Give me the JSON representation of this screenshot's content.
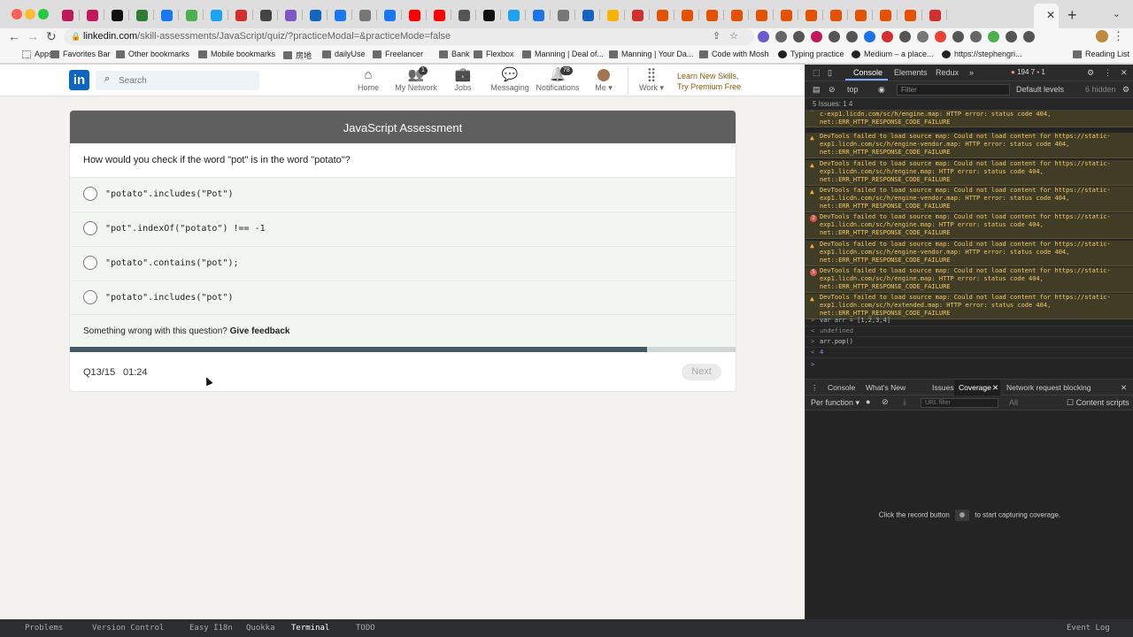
{
  "browser": {
    "url_host": "linkedin.com",
    "url_path": "/skill-assessments/JavaScript/quiz/?practiceModal=&practiceMode=false",
    "bookmarks": [
      {
        "label": "Apps"
      },
      {
        "label": "Favorites Bar"
      },
      {
        "label": "Other bookmarks"
      },
      {
        "label": "Mobile bookmarks"
      },
      {
        "label": "房地"
      },
      {
        "label": "dailyUse"
      },
      {
        "label": "Freelancer"
      },
      {
        "label": "Bank"
      },
      {
        "label": "Flexbox"
      },
      {
        "label": "Manning | Deal of..."
      },
      {
        "label": "Manning | Your Da..."
      },
      {
        "label": "Code with Mosh"
      },
      {
        "label": "Typing practice"
      },
      {
        "label": "Medium – a place..."
      },
      {
        "label": "https://stephengri..."
      }
    ],
    "reading_list": "Reading List",
    "profile_badge": "59",
    "tab_colors": [
      "#c2185b",
      "#c2185b",
      "#111111",
      "#2e7d32",
      "#1877f2",
      "#4caf50",
      "#1da1f2",
      "#d32f2f",
      "#444444",
      "#7e57c2",
      "#1565c0",
      "#1877f2",
      "#777777",
      "#1877f2",
      "#ff0000",
      "#ff0000",
      "#555555",
      "#111111",
      "#1da1f2",
      "#1a73e8",
      "#777777",
      "#1565c0",
      "#f4b400",
      "#d32f2f",
      "#e65100",
      "#e65100",
      "#e65100",
      "#e65100",
      "#e65100",
      "#e65100",
      "#e65100",
      "#e65100",
      "#e65100",
      "#e65100",
      "#e65100",
      "#d32f2f"
    ]
  },
  "linkedin": {
    "search_placeholder": "Search",
    "nav": [
      {
        "label": "Home",
        "icon": "house-icon"
      },
      {
        "label": "My Network",
        "icon": "people-icon",
        "badge": "1"
      },
      {
        "label": "Jobs",
        "icon": "briefcase-icon"
      },
      {
        "label": "Messaging",
        "icon": "chat-icon"
      },
      {
        "label": "Notifications",
        "icon": "bell-icon",
        "badge": "78"
      },
      {
        "label": "Me",
        "icon": "avatar"
      },
      {
        "label": "Work",
        "icon": "grid-icon"
      }
    ],
    "premium_line1": "Learn New Skills,",
    "premium_line2": "Try Premium Free"
  },
  "assessment": {
    "title": "JavaScript Assessment",
    "question": "How would you check if the word \"pot\" is in the word \"potato\"?",
    "options": [
      "\"potato\".includes(\"Pot\")",
      "\"pot\".indexOf(\"potato\") !== -1",
      "\"potato\".contains(\"pot\");",
      "\"potato\".includes(\"pot\")"
    ],
    "feedback_prompt": "Something wrong with this question?",
    "feedback_link": "Give feedback",
    "progress_fraction": 0.8667,
    "question_counter": "Q13/15",
    "timer": "01:24",
    "next_label": "Next"
  },
  "devtools": {
    "tabs": [
      "Console",
      "Elements",
      "Redux",
      "»"
    ],
    "counts": "194  7",
    "errors_count": "1",
    "context": "top",
    "filter_placeholder": "Filter",
    "levels": "Default levels",
    "hidden": "6 hidden",
    "issues": "5 Issues:  1  4",
    "messages": [
      {
        "level": "warn",
        "text": "c-exp1.licdn.com/sc/h/engine.map: HTTP error: status code 404, net::ERR_HTTP_RESPONSE_CODE_FAILURE"
      },
      {
        "level": "warn",
        "text": "DevTools failed to load source map: Could not load content for https://static-exp1.licdn.com/sc/h/engine-vendor.map: HTTP error: status code 404, net::ERR_HTTP_RESPONSE_CODE_FAILURE"
      },
      {
        "level": "warn",
        "text": "DevTools failed to load source map: Could not load content for https://static-exp1.licdn.com/sc/h/engine.map: HTTP error: status code 404, net::ERR_HTTP_RESPONSE_CODE_FAILURE"
      },
      {
        "level": "warn",
        "text": "DevTools failed to load source map: Could not load content for https://static-exp1.licdn.com/sc/h/engine-vendor.map: HTTP error: status code 404, net::ERR_HTTP_RESPONSE_CODE_FAILURE"
      },
      {
        "level": "count",
        "count": "2",
        "text": "DevTools failed to load source map: Could not load content for https://static-exp1.licdn.com/sc/h/engine.map: HTTP error: status code 404, net::ERR_HTTP_RESPONSE_CODE_FAILURE"
      },
      {
        "level": "warn",
        "text": "DevTools failed to load source map: Could not load content for https://static-exp1.licdn.com/sc/h/engine-vendor.map: HTTP error: status code 404, net::ERR_HTTP_RESPONSE_CODE_FAILURE"
      },
      {
        "level": "count",
        "count": "5",
        "text": "DevTools failed to load source map: Could not load content for https://static-exp1.licdn.com/sc/h/engine.map: HTTP error: status code 404, net::ERR_HTTP_RESPONSE_CODE_FAILURE"
      },
      {
        "level": "warn",
        "text": "DevTools failed to load source map: Could not load content for https://static-exp1.licdn.com/sc/h/extended.map: HTTP error: status code 404, net::ERR_HTTP_RESPONSE_CODE_FAILURE"
      }
    ],
    "repl": [
      {
        "prompt": ">",
        "text": "var arr = [1,2,3,4]",
        "color": "#9bbbdc"
      },
      {
        "prompt": "<",
        "text": "undefined",
        "color": "#888888"
      },
      {
        "prompt": ">",
        "text": "arr.pop()",
        "color": "#cccccc"
      },
      {
        "prompt": "<",
        "text": "4",
        "color": "#9980ff"
      }
    ],
    "drawer_tabs": [
      "Console",
      "What's New",
      "Issues",
      "Coverage",
      "Network request blocking"
    ],
    "coverage": {
      "mode": "Per function",
      "url_placeholder": "URL filter",
      "type": "All",
      "content_scripts": "Content scripts",
      "msg_before": "Click the record button",
      "msg_after": "to start capturing coverage."
    }
  },
  "ide": {
    "items": [
      "Problems",
      "Version Control",
      "Easy I18n",
      "Quokka",
      "Terminal",
      "TODO"
    ],
    "event_log": "Event Log"
  }
}
